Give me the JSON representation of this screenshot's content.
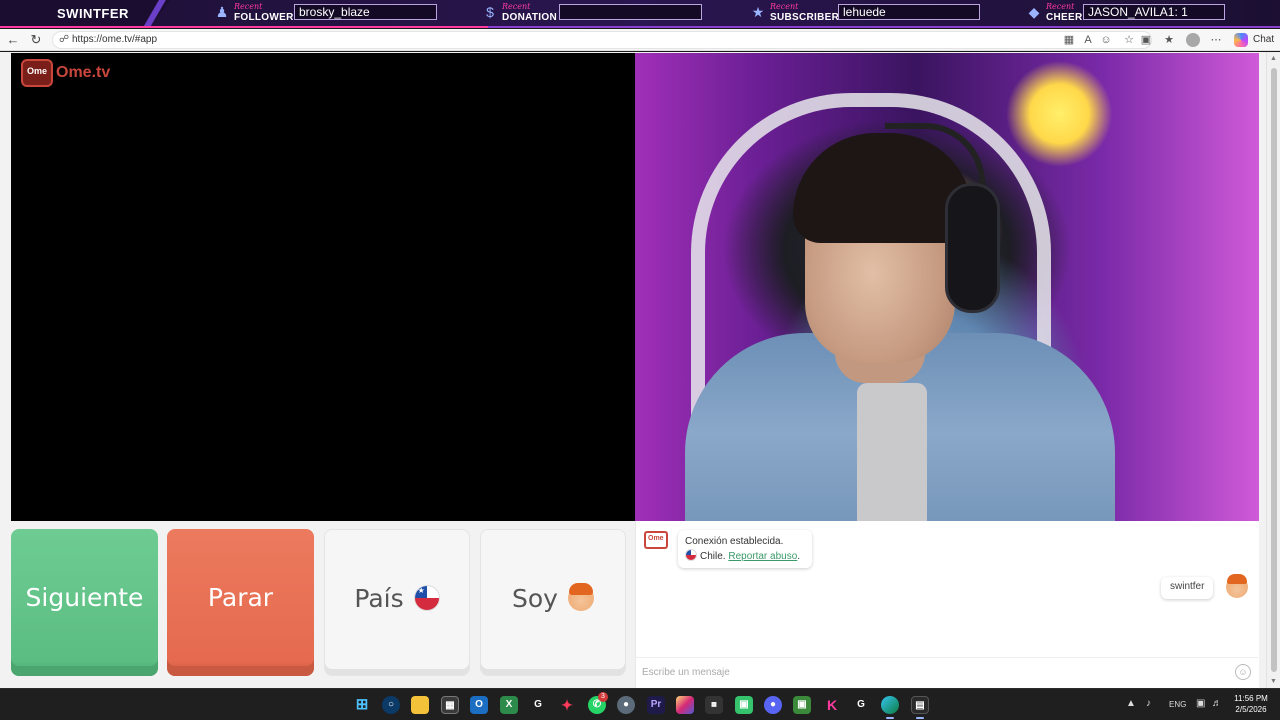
{
  "overlay": {
    "brand": "SWINTFER",
    "recent_word": "Recent",
    "follower": {
      "label": "FOLLOWER",
      "value": "brosky_blaze",
      "icon": "person-plus-icon"
    },
    "donation": {
      "label": "DONATION",
      "value": "",
      "icon": "dollar-icon"
    },
    "subscriber": {
      "label": "SUBSCRIBER",
      "value": "lehuede",
      "icon": "star-icon"
    },
    "cheer": {
      "label": "CHEER",
      "value": "JASON_AVILA1: 1",
      "icon": "bits-drop-icon"
    }
  },
  "browser": {
    "url": "https://ome.tv/#app",
    "chat_button": "Chat"
  },
  "site": {
    "logo_tv": "Ome",
    "logo_text": "Ome.tv",
    "buttons": {
      "next": "Siguiente",
      "stop": "Parar",
      "country": "País",
      "gender": "Soy"
    },
    "chat": {
      "system_line1": "Conexión establecida.",
      "system_country": "Chile.",
      "report_link": "Reportar abuso",
      "report_suffix": ".",
      "my_message": "swintfer",
      "input_placeholder": "Escribe un mensaje"
    },
    "colors": {
      "next": "#5bbd82",
      "stop": "#e56a4f",
      "link": "#3a9a6a"
    }
  },
  "taskbar": {
    "lang": "ENG",
    "time": "11:56 PM",
    "date": "2/5/2026",
    "whatsapp_badge": "3"
  }
}
